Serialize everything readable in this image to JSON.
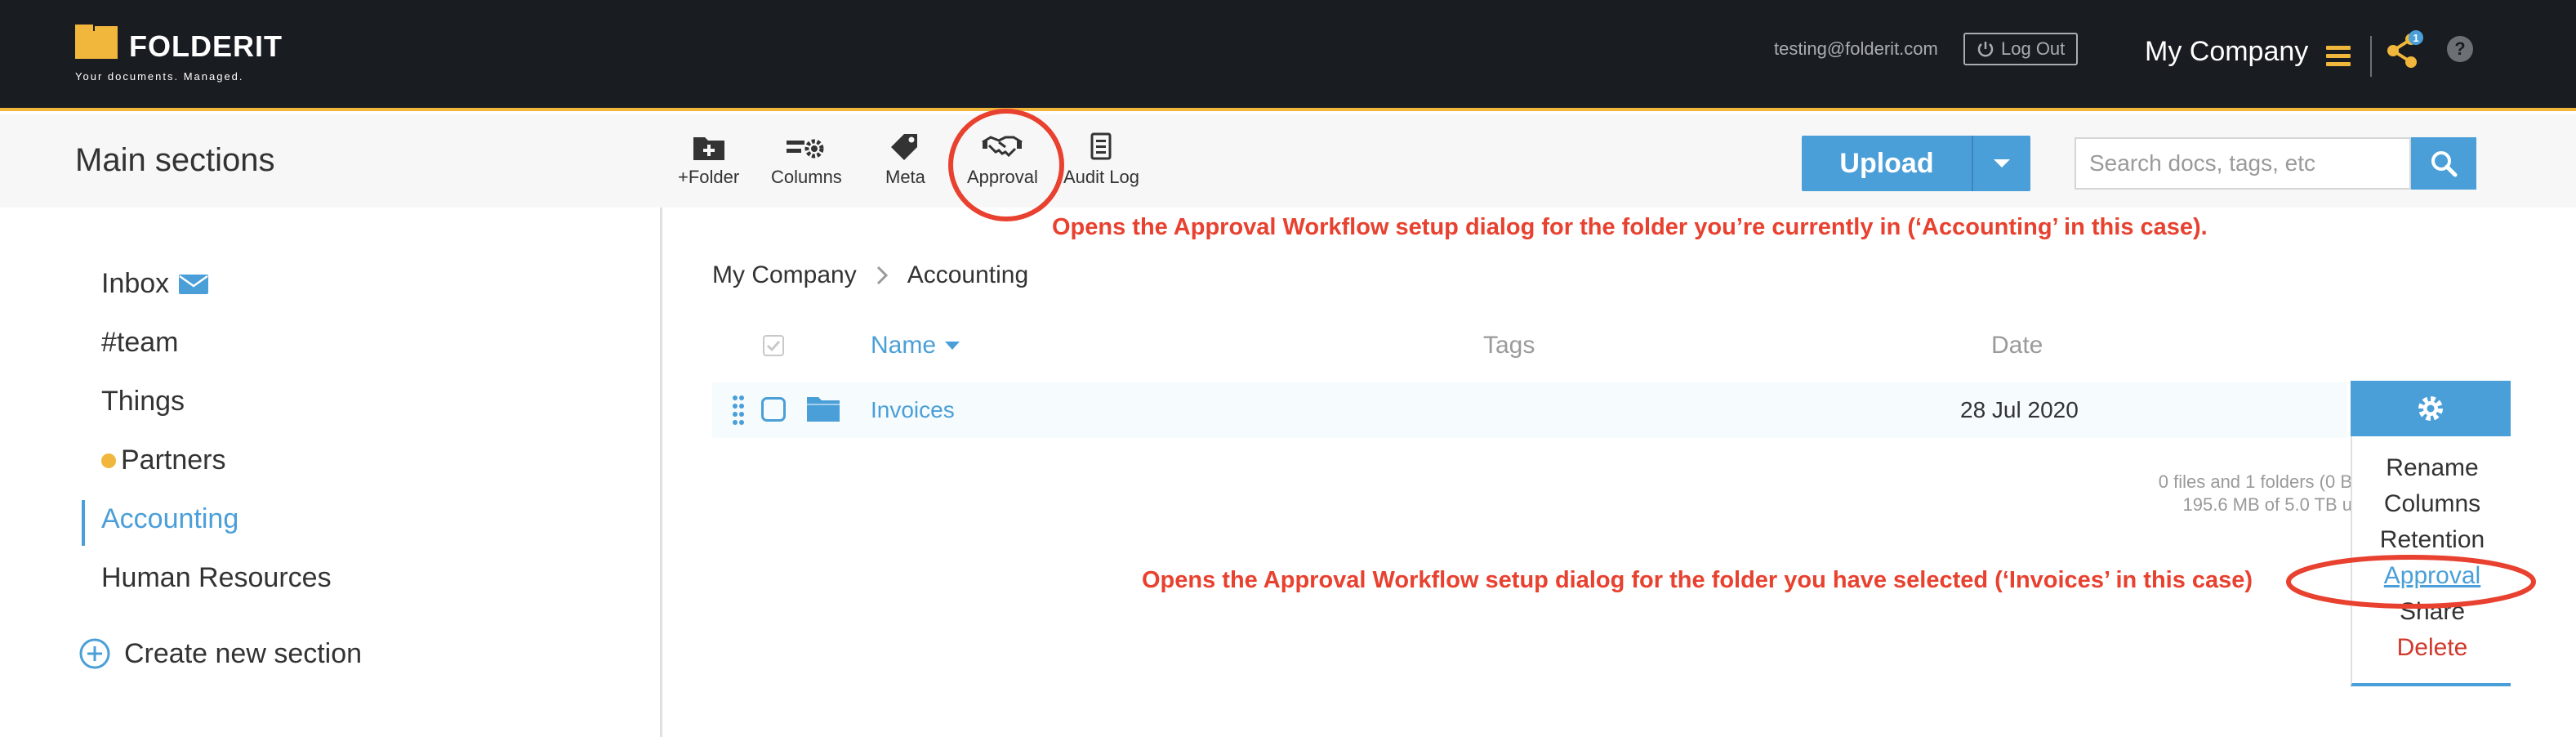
{
  "brand": {
    "name": "FOLDERIT",
    "tagline": "Your documents. Managed."
  },
  "header": {
    "user_email": "testing@folderit.com",
    "logout_label": "Log Out",
    "company": "My Company",
    "notification_count": "1",
    "help_label": "?"
  },
  "toolbar": {
    "section_title": "Main sections",
    "tools": [
      {
        "label": "+Folder",
        "icon": "folder-plus-icon"
      },
      {
        "label": "Columns",
        "icon": "columns-gear-icon"
      },
      {
        "label": "Meta",
        "icon": "tag-icon"
      },
      {
        "label": "Approval",
        "icon": "handshake-icon"
      },
      {
        "label": "Audit Log",
        "icon": "document-list-icon"
      }
    ],
    "upload_label": "Upload",
    "search_placeholder": "Search docs, tags, etc"
  },
  "sidebar": {
    "items": [
      {
        "label": "Inbox"
      },
      {
        "label": "#team"
      },
      {
        "label": "Things"
      },
      {
        "label": "Partners"
      },
      {
        "label": "Accounting"
      },
      {
        "label": "Human Resources"
      }
    ],
    "create_label": "Create new section"
  },
  "breadcrumb": {
    "root": "My Company",
    "current": "Accounting"
  },
  "table": {
    "columns": {
      "name": "Name",
      "tags": "Tags",
      "date": "Date"
    },
    "rows": [
      {
        "name": "Invoices",
        "tags": "",
        "date": "28 Jul 2020"
      }
    ],
    "summary_line1": "0 files and 1 folders (0 B",
    "summary_line2": "195.6 MB of 5.0 TB u"
  },
  "row_menu": {
    "items": [
      "Rename",
      "Columns",
      "Retention",
      "Approval",
      "Share",
      "Delete"
    ]
  },
  "annotations": {
    "top": "Opens the Approval Workflow setup dialog for the folder you’re currently in (‘Accounting’ in this case).",
    "bottom": "Opens the Approval Workflow setup dialog for the folder you have selected (‘Invoices’ in this case)"
  },
  "colors": {
    "accent": "#4a9fd8",
    "brand_yellow": "#f0b73c",
    "annotation_red": "#e8412f",
    "topbar": "#191c20"
  }
}
